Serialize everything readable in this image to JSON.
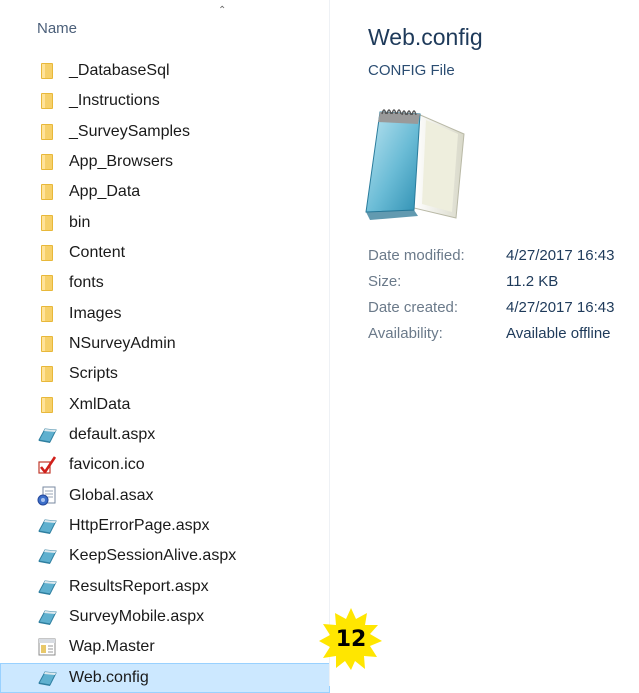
{
  "file_list": {
    "column_header": "Name",
    "items": [
      {
        "name": "_DatabaseSql",
        "icon": "folder-icon"
      },
      {
        "name": "_Instructions",
        "icon": "folder-icon"
      },
      {
        "name": "_SurveySamples",
        "icon": "folder-icon"
      },
      {
        "name": "App_Browsers",
        "icon": "folder-icon"
      },
      {
        "name": "App_Data",
        "icon": "folder-icon"
      },
      {
        "name": "bin",
        "icon": "folder-icon"
      },
      {
        "name": "Content",
        "icon": "folder-icon"
      },
      {
        "name": "fonts",
        "icon": "folder-icon"
      },
      {
        "name": "Images",
        "icon": "folder-icon"
      },
      {
        "name": "NSurveyAdmin",
        "icon": "folder-icon"
      },
      {
        "name": "Scripts",
        "icon": "folder-icon"
      },
      {
        "name": "XmlData",
        "icon": "folder-icon"
      },
      {
        "name": "default.aspx",
        "icon": "aspx-file-icon"
      },
      {
        "name": "favicon.ico",
        "icon": "checkmark-icon"
      },
      {
        "name": "Global.asax",
        "icon": "asax-file-icon"
      },
      {
        "name": "HttpErrorPage.aspx",
        "icon": "aspx-file-icon"
      },
      {
        "name": "KeepSessionAlive.aspx",
        "icon": "aspx-file-icon"
      },
      {
        "name": "ResultsReport.aspx",
        "icon": "aspx-file-icon"
      },
      {
        "name": "SurveyMobile.aspx",
        "icon": "aspx-file-icon"
      },
      {
        "name": "Wap.Master",
        "icon": "master-file-icon"
      },
      {
        "name": "Web.config",
        "icon": "config-file-icon",
        "selected": true
      }
    ]
  },
  "details": {
    "title": "Web.config",
    "type": "CONFIG File",
    "icon": "notepad-icon",
    "properties": [
      {
        "label": "Date modified:",
        "value": "4/27/2017 16:43"
      },
      {
        "label": "Size:",
        "value": "11.2 KB"
      },
      {
        "label": "Date created:",
        "value": "4/27/2017 16:43"
      },
      {
        "label": "Availability:",
        "value": "Available offline"
      }
    ]
  },
  "step_badge": {
    "number": "12",
    "color": "#ffe600"
  },
  "colors": {
    "selection": "#cce8ff",
    "folder": "#f4c64a",
    "header_text": "#4c607a",
    "detail_title": "#1e3a5a"
  }
}
